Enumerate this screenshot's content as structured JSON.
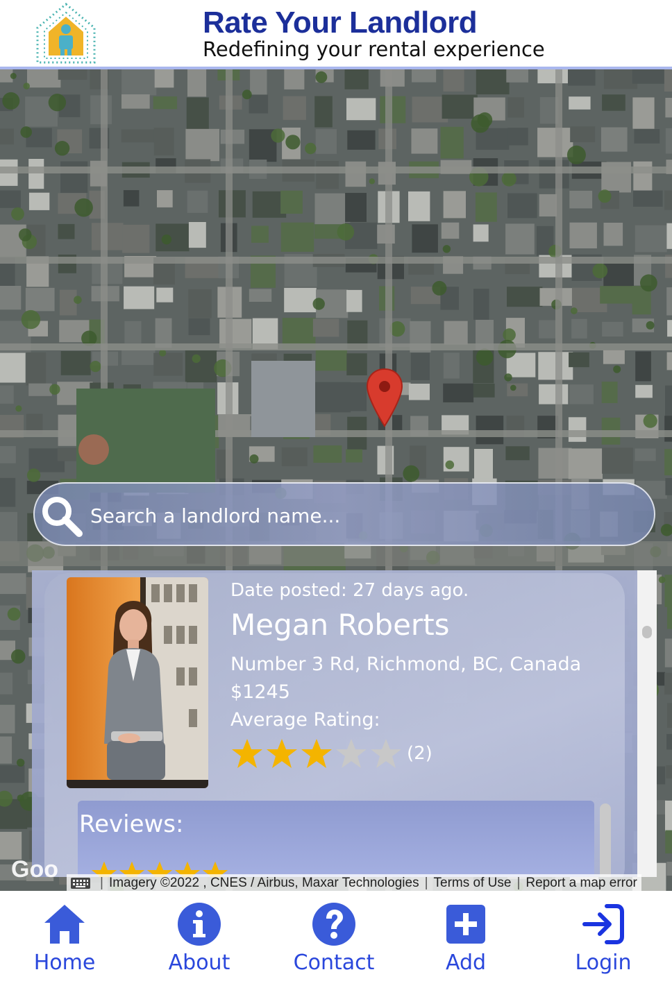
{
  "header": {
    "title": "Rate Your Landlord",
    "subtitle": "Redefining your rental experience"
  },
  "search": {
    "placeholder": "Search a landlord name..."
  },
  "listing": {
    "date_posted": "Date posted: 27 days ago.",
    "name": "Megan Roberts",
    "address": "Number 3 Rd, Richmond, BC, Canada",
    "price": "$1245",
    "average_label": "Average Rating:",
    "rating": 3,
    "rating_max": 5,
    "rating_count": "(2)",
    "reviews_label": "Reviews:",
    "review_rating": 5
  },
  "map": {
    "google_logo": "Goo",
    "imagery": "Imagery ©2022 , CNES / Airbus, Maxar Technologies",
    "terms": "Terms of Use",
    "report": "Report a map error"
  },
  "nav": {
    "home": "Home",
    "about": "About",
    "contact": "Contact",
    "add": "Add",
    "login": "Login"
  },
  "colors": {
    "brand": "#1c2f9a",
    "nav_accent": "#2a47dc",
    "star_filled": "#f4b400",
    "star_empty": "#c8c8c8",
    "pin": "#d83b2d"
  }
}
